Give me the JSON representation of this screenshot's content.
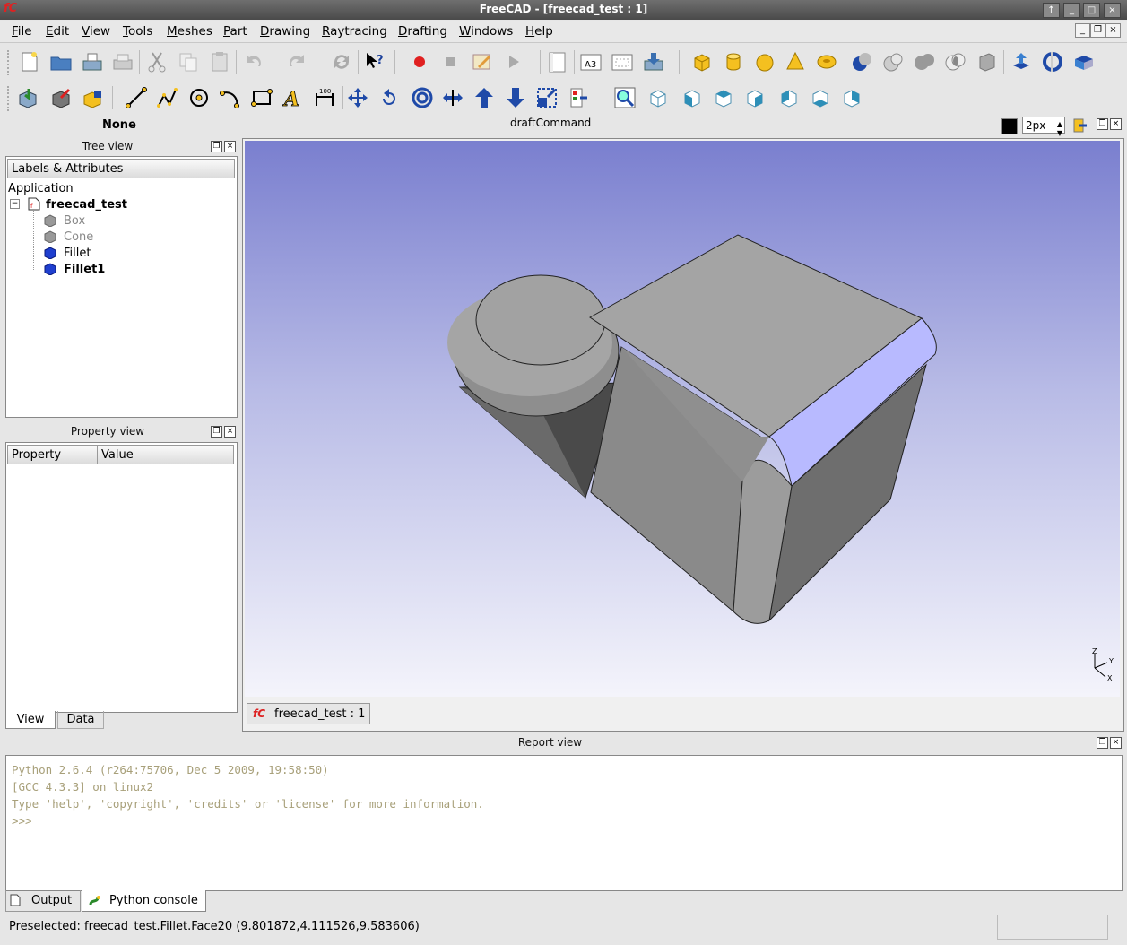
{
  "window": {
    "title": "FreeCAD - [freecad_test : 1]",
    "logo": "fC"
  },
  "menu": [
    "File",
    "Edit",
    "View",
    "Tools",
    "Meshes",
    "Part",
    "Drawing",
    "Raytracing",
    "Drafting",
    "Windows",
    "Help"
  ],
  "draft": {
    "selected": "None",
    "command": "draftCommand",
    "linewidth": "2px"
  },
  "tree_view": {
    "title": "Tree view",
    "header": "Labels & Attributes",
    "root": "Application",
    "document": "freecad_test",
    "items": [
      "Box",
      "Cone",
      "Fillet",
      "Fillet1"
    ]
  },
  "property_view": {
    "title": "Property view",
    "col_property": "Property",
    "col_value": "Value",
    "tabs": [
      "View",
      "Data"
    ]
  },
  "viewer": {
    "doc_tab": "freecad_test : 1",
    "axis_labels": [
      "Z",
      "Y",
      "X"
    ]
  },
  "report": {
    "title": "Report view",
    "lines": [
      "Python 2.6.4 (r264:75706, Dec  5 2009, 19:58:50)",
      "[GCC 4.3.3] on linux2",
      "Type 'help', 'copyright', 'credits' or 'license' for more information.",
      ">>>"
    ],
    "tabs": [
      "Output",
      "Python console"
    ]
  },
  "status": {
    "text": "Preselected: freecad_test.Fillet.Face20 (9.801872,4.111526,9.583606)"
  },
  "colors": {
    "viewport_top": "#7a7fcf",
    "viewport_bottom": "#f4f4fb",
    "highlight_face": "#b8baff",
    "console_text": "#a8a07a"
  }
}
